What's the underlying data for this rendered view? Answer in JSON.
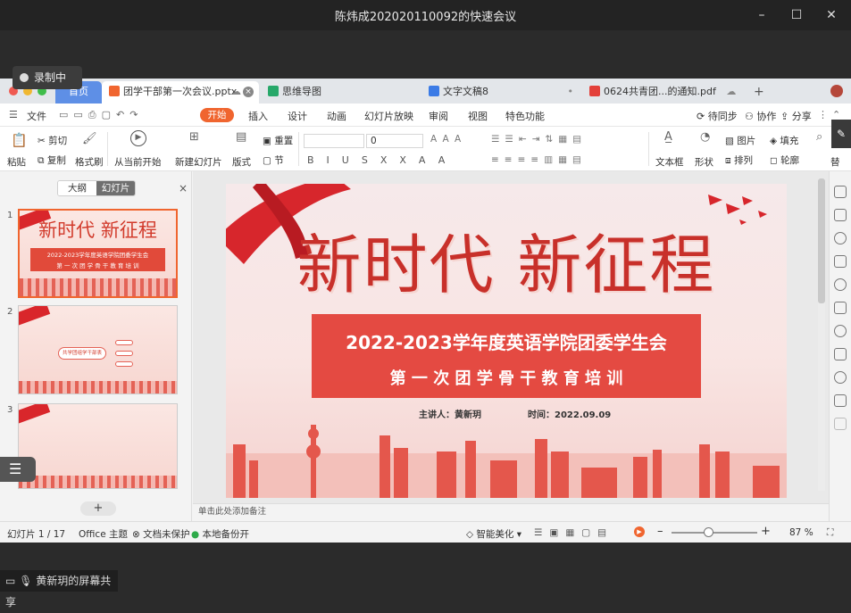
{
  "meeting": {
    "title": "陈炜成202020110092的快速会议",
    "recording": "录制中",
    "sharer": "黄新玥的屏幕共享"
  },
  "tabs": [
    {
      "label": "首页"
    },
    {
      "label": "团学干部第一次会议.pptx"
    },
    {
      "label": "思维导图"
    },
    {
      "label": "文字文稿8"
    },
    {
      "label": "0624共青团...的通知.pdf"
    }
  ],
  "menu": {
    "file": "文件",
    "start": "开始",
    "items": [
      "插入",
      "设计",
      "动画",
      "幻灯片放映",
      "审阅",
      "视图",
      "特色功能"
    ],
    "right": [
      "待同步",
      "协作",
      "分享"
    ]
  },
  "ribbon": {
    "paste": "粘贴",
    "cut": "剪切",
    "copy": "复制",
    "format_painter": "格式刷",
    "play_from_current": "从当前开始",
    "new_slide": "新建幻灯片",
    "layout": "版式",
    "reset": "重置",
    "section": "节",
    "font_size": "0",
    "textbox": "文本框",
    "shape": "形状",
    "picture": "图片",
    "arrange": "排列",
    "fill": "填充",
    "outline": "轮廓",
    "replace": "替"
  },
  "leftpane": {
    "outline_tab": "大纲",
    "slides_tab": "幻灯片",
    "close": "×",
    "add": "+",
    "thumbs": [
      {
        "num": "1",
        "title": "新时代 新征程",
        "line1": "2022-2023学年度英语学院团委学生会",
        "line2": "第 一 次 团 学 骨 干 教 育 培 训"
      },
      {
        "num": "2",
        "node": "共学团组学干部表"
      },
      {
        "num": "3"
      }
    ]
  },
  "slide": {
    "title": "新时代 新征程",
    "subtitle1": "2022-2023学年度英语学院团委学生会",
    "subtitle2": "第 一 次 团 学 骨 干 教 育 培 训",
    "speaker": "主讲人：黄新玥",
    "time": "时间：2022.09.09"
  },
  "notes_placeholder": "单击此处添加备注",
  "status": {
    "slide_count": "幻灯片 1 / 17",
    "theme": "Office 主题",
    "protect": "文档未保护",
    "backup": "本地备份开",
    "beautify": "智能美化",
    "zoom": "87 %"
  },
  "colors": {
    "accent": "#f0652f",
    "slide_red": "#e0342b"
  }
}
